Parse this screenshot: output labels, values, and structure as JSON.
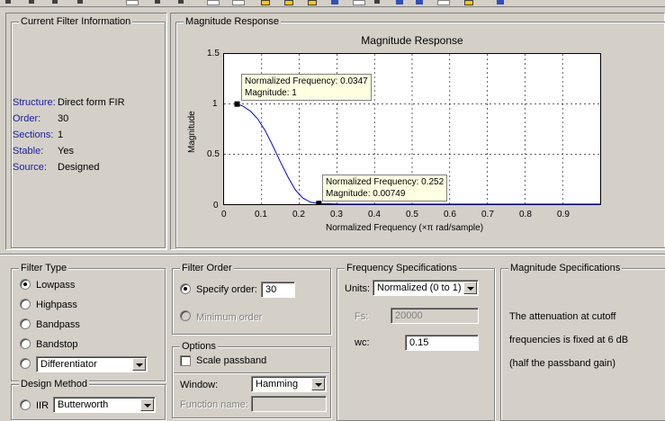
{
  "current_filter_info": {
    "title": "Current Filter Information",
    "rows": [
      {
        "label": "Structure:",
        "value": "Direct form FIR"
      },
      {
        "label": "Order:",
        "value": "30"
      },
      {
        "label": "Sections:",
        "value": "1"
      },
      {
        "label": "Stable:",
        "value": "Yes"
      },
      {
        "label": "Source:",
        "value": "Designed"
      }
    ]
  },
  "magnitude_panel": {
    "group_title": "Magnitude Response",
    "plot_title": "Magnitude Response",
    "ylabel": "Magnitude",
    "xlabel": "Normalized Frequency  (×π rad/sample)",
    "datatips": [
      {
        "line1": "Normalized Frequency: 0.0347",
        "line2": "Magnitude: 1"
      },
      {
        "line1": "Normalized Frequency: 0.252",
        "line2": "Magnitude: 0.00749"
      }
    ]
  },
  "chart_data": {
    "type": "line",
    "title": "Magnitude Response",
    "xlabel": "Normalized Frequency  (×π rad/sample)",
    "ylabel": "Magnitude",
    "xlim": [
      0,
      1
    ],
    "ylim": [
      0,
      1.5
    ],
    "xticks": [
      "0",
      "0.1",
      "0.2",
      "0.3",
      "0.4",
      "0.5",
      "0.6",
      "0.7",
      "0.8",
      "0.9"
    ],
    "yticks": [
      "0",
      "0.5",
      "1",
      "1.5"
    ],
    "grid": true,
    "series": [
      {
        "color": "#0000ff",
        "x": [
          0.0347,
          0.05,
          0.07,
          0.09,
          0.11,
          0.13,
          0.15,
          0.17,
          0.19,
          0.21,
          0.23,
          0.252,
          0.3,
          0.4,
          0.5,
          0.6,
          0.7,
          0.8,
          0.9,
          1.0
        ],
        "y": [
          1.0,
          0.98,
          0.93,
          0.85,
          0.73,
          0.58,
          0.42,
          0.27,
          0.14,
          0.06,
          0.02,
          0.00749,
          0.002,
          0.001,
          0.001,
          0.001,
          0.001,
          0.001,
          0.001,
          0.001
        ]
      }
    ],
    "markers": [
      {
        "x": 0.0347,
        "y": 1.0
      },
      {
        "x": 0.252,
        "y": 0.00749
      }
    ]
  },
  "filter_type": {
    "title": "Filter Type",
    "options": [
      "Lowpass",
      "Highpass",
      "Bandpass",
      "Bandstop"
    ],
    "selected": "Lowpass",
    "other_combo": "Differentiator"
  },
  "design_method": {
    "title": "Design Method",
    "iir_label": "IIR",
    "iir_combo": "Butterworth"
  },
  "filter_order": {
    "title": "Filter Order",
    "specify_label": "Specify order:",
    "specify_value": "30",
    "minimum_label": "Minimum order"
  },
  "options": {
    "title": "Options",
    "scale_passband_label": "Scale passband",
    "window_label": "Window:",
    "window_value": "Hamming",
    "function_name_label": "Function name:"
  },
  "frequency_specs": {
    "title": "Frequency Specifications",
    "units_label": "Units:",
    "units_value": "Normalized (0 to 1)",
    "fs_label": "Fs:",
    "fs_value": "20000",
    "wc_label": "wc:",
    "wc_value": "0.15"
  },
  "magnitude_specs": {
    "title": "Magnitude Specifications",
    "lines": [
      "The attenuation at cutoff",
      "frequencies is fixed at 6 dB",
      "(half the passband gain)"
    ]
  }
}
